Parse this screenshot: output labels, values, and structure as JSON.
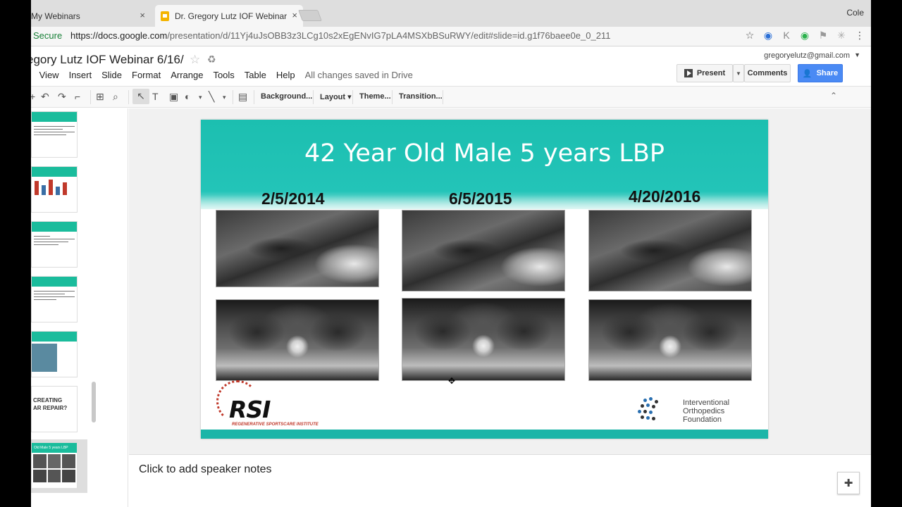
{
  "browser": {
    "tabs": [
      {
        "label": "My Webinars",
        "close": "×"
      },
      {
        "label": "Dr. Gregory Lutz IOF Webinar",
        "close": "×"
      }
    ],
    "profile_name": "Cole",
    "secure_label": "Secure",
    "url_host": "https://docs.google.com",
    "url_path": "/presentation/d/11Yj4uJsOBB3z3LCg10s2xEgENvIG7pLA4MSXbBSuRWY/edit#slide=id.g1f76baee0e_0_211"
  },
  "docs": {
    "title": "egory Lutz IOF Webinar 6/16/",
    "menu": [
      "t",
      "View",
      "Insert",
      "Slide",
      "Format",
      "Arrange",
      "Tools",
      "Table",
      "Help"
    ],
    "save_status": "All changes saved in Drive",
    "account": "gregoryelutz@gmail.com",
    "present_label": "Present",
    "comments_label": "Comments",
    "share_label": "Share"
  },
  "toolbar": {
    "background_label": "Background...",
    "layout_label": "Layout",
    "theme_label": "Theme...",
    "transition_label": "Transition..."
  },
  "filmstrip": {
    "thumb6_text": "CREATING\nAR REPAIR?",
    "thumb8_text": "Old Male 5 years LBP"
  },
  "slide": {
    "title": "42 Year Old Male 5 years LBP",
    "dates": [
      "2/5/2014",
      "6/5/2015",
      "4/20/2016"
    ],
    "rsi_text": "RSI",
    "rsi_subtitle": "REGENERATIVE SPORTSCARE INSTITUTE",
    "iof_text": "Interventional\nOrthopedics\nFoundation"
  },
  "notes": {
    "placeholder": "Click to add speaker notes"
  },
  "colors": {
    "slide_accent": "#1cbfb0",
    "share_button": "#4a8af4",
    "rsi_red": "#c0392b"
  }
}
